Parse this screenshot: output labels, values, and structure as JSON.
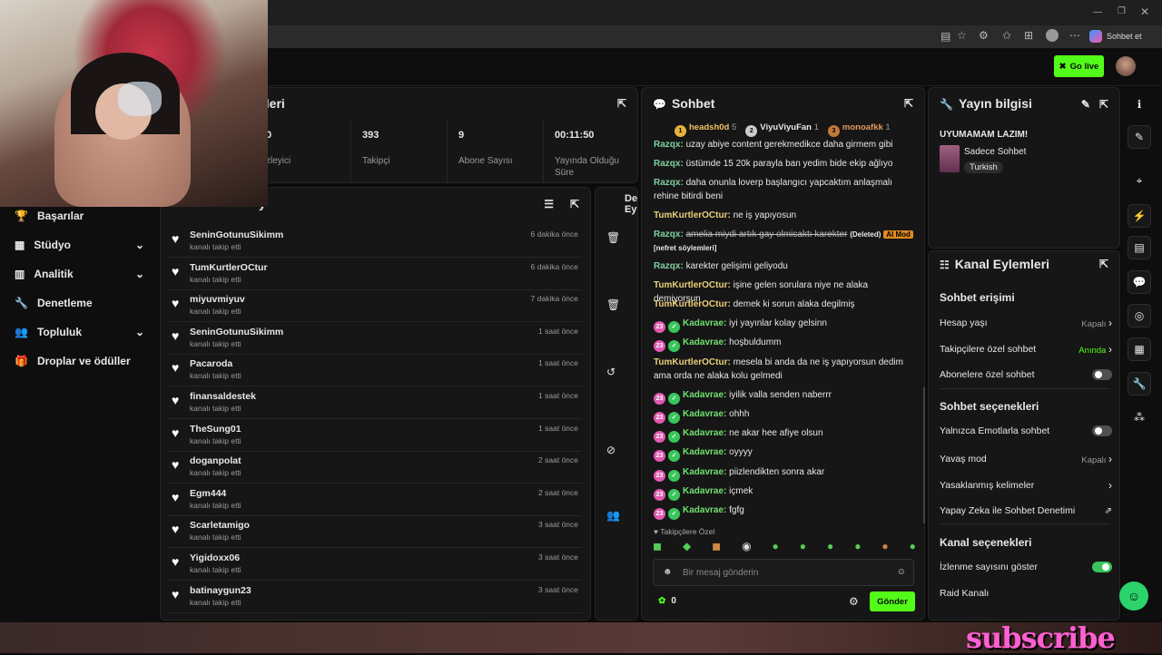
{
  "browser": {
    "chat_button": "Sohbet et"
  },
  "appbar": {
    "go_live": "Go live"
  },
  "nav": [
    {
      "label": "Başarılar",
      "icon": "trophy-icon"
    },
    {
      "label": "Stüdyo",
      "icon": "studio-icon"
    },
    {
      "label": "Analitik",
      "icon": "analytics-icon"
    },
    {
      "label": "Denetleme",
      "icon": "wrench-icon"
    },
    {
      "label": "Topluluk",
      "icon": "community-icon"
    },
    {
      "label": "Droplar ve ödüller",
      "icon": "gift-icon"
    }
  ],
  "stats_panel": {
    "title_fragment": "kleri",
    "stats": [
      {
        "value": "0",
        "label": "zleyici"
      },
      {
        "value": "393",
        "label": "Takipçi"
      },
      {
        "value": "9",
        "label": "Abone Sayısı"
      },
      {
        "value": "00:11:50",
        "label": "Yayında Olduğu Süre"
      }
    ]
  },
  "activity": {
    "title_fragment": "y",
    "items": [
      {
        "name": "SeninGotunuSikimm",
        "sub": "kanalı takip etti",
        "time": "6 dakika önce"
      },
      {
        "name": "TumKurtlerOCtur",
        "sub": "kanalı takip etti",
        "time": "6 dakika önce"
      },
      {
        "name": "miyuvmiyuv",
        "sub": "kanalı takip etti",
        "time": "7 dakika önce"
      },
      {
        "name": "SeninGotunuSikimm",
        "sub": "kanalı takip etti",
        "time": "1 saat önce"
      },
      {
        "name": "Pacaroda",
        "sub": "kanalı takip etti",
        "time": "1 saat önce"
      },
      {
        "name": "finansaldestek",
        "sub": "kanalı takip etti",
        "time": "1 saat önce"
      },
      {
        "name": "TheSung01",
        "sub": "kanalı takip etti",
        "time": "1 saat önce"
      },
      {
        "name": "doganpolat",
        "sub": "kanalı takip etti",
        "time": "2 saat önce"
      },
      {
        "name": "Egm444",
        "sub": "kanalı takip etti",
        "time": "2 saat önce"
      },
      {
        "name": "Scarletamigo",
        "sub": "kanalı takip etti",
        "time": "3 saat önce"
      },
      {
        "name": "Yigidoxx06",
        "sub": "kanalı takip etti",
        "time": "3 saat önce"
      },
      {
        "name": "batinaygun23",
        "sub": "kanalı takip etti",
        "time": "3 saat önce"
      }
    ]
  },
  "mod_panel": {
    "title_a": "De",
    "title_b": "Ey"
  },
  "chat": {
    "title": "Sohbet",
    "leaders": [
      {
        "rank": "1",
        "name": "headsh0d",
        "count": "5"
      },
      {
        "rank": "2",
        "name": "ViyuViyuFan",
        "count": "1"
      },
      {
        "rank": "3",
        "name": "monoafkk",
        "count": "1"
      }
    ],
    "messages": [
      {
        "user": "Razqx",
        "text": "uzay abiye content gerekmedikce daha girmem gibi"
      },
      {
        "user": "Razqx",
        "text": "üstümde 15 20k parayla ban yedim bide ekip ağlıyo"
      },
      {
        "user": "Razqx",
        "text": "daha onunla loverp başlangıcı yapcaktım anlaşmalı rehine bitirdi beni"
      },
      {
        "user": "TumKurtlerOCtur",
        "text": "ne iş yapıyosun"
      },
      {
        "user": "Razqx",
        "text": "amelia miydi artık gay olmicaktı karekter",
        "deleted": "(Deleted)",
        "aimod": "AI Mod",
        "reason": "[nefret söylemleri]"
      },
      {
        "user": "Razqx",
        "text": "karekter gelişimi geliyodu"
      },
      {
        "user": "TumKurtlerOCtur",
        "text": "işine gelen sorulara niye ne alaka demiyorsun"
      },
      {
        "user": "TumKurtlerOCtur",
        "text": "demek ki sorun alaka degilmiş"
      },
      {
        "user": "Kadavrae",
        "text": "iyi yayınlar kolay gelsinn"
      },
      {
        "user": "Kadavrae",
        "text": "hoşbuldumm"
      },
      {
        "user": "TumKurtlerOCtur",
        "text": "mesela bi anda da ne iş yapıyorsun dedim ama orda ne alaka kolu gelmedi"
      },
      {
        "user": "Kadavrae",
        "text": "iyilik valla senden naberrr"
      },
      {
        "user": "Kadavrae",
        "text": "ohhh"
      },
      {
        "user": "Kadavrae",
        "text": "ne akar hee afiye olsun"
      },
      {
        "user": "Kadavrae",
        "text": "oyyyy"
      },
      {
        "user": "Kadavrae",
        "text": "piizlendikten sonra akar"
      },
      {
        "user": "Kadavrae",
        "text": "içmek"
      },
      {
        "user": "Kadavrae",
        "text": "fgfg"
      }
    ],
    "badge_sub": "23",
    "followers_only": "Takipçilere Özel",
    "input_placeholder": "Bir mesaj gönderin",
    "points": "0",
    "send": "Gönder"
  },
  "stream_info": {
    "title": "Yayın bilgisi",
    "stream_title": "UYUMAMAM LAZIM!",
    "category": "Sadece Sohbet",
    "tag": "Turkish"
  },
  "channel_actions": {
    "title": "Kanal Eylemleri",
    "chat_access": "Sohbet erişimi",
    "rows1": [
      {
        "label": "Hesap yaşı",
        "value": "Kapalı"
      },
      {
        "label": "Takipçilere özel sohbet",
        "value": "Anında"
      },
      {
        "label": "Abonelere özel sohbet",
        "value": ""
      }
    ],
    "chat_options": "Sohbet seçenekleri",
    "rows2": [
      {
        "label": "Yalnızca Emotlarla sohbet",
        "value": ""
      },
      {
        "label": "Yavaş mod",
        "value": "Kapalı"
      },
      {
        "label": "Yasaklanmış kelimeler",
        "value": ""
      },
      {
        "label": "Yapay Zeka ile Sohbet Denetimi",
        "value": ""
      }
    ],
    "channel_options": "Kanal seçenekleri",
    "rows3": [
      {
        "label": "İzlenme sayısını göster",
        "value": ""
      },
      {
        "label": "Raid Kanalı",
        "value": ""
      }
    ]
  },
  "overlay": {
    "subscribe": "subscribe"
  },
  "colors": {
    "accent": "#53fc18",
    "panel": "#161616",
    "subscribe": "#ff5fd2"
  }
}
